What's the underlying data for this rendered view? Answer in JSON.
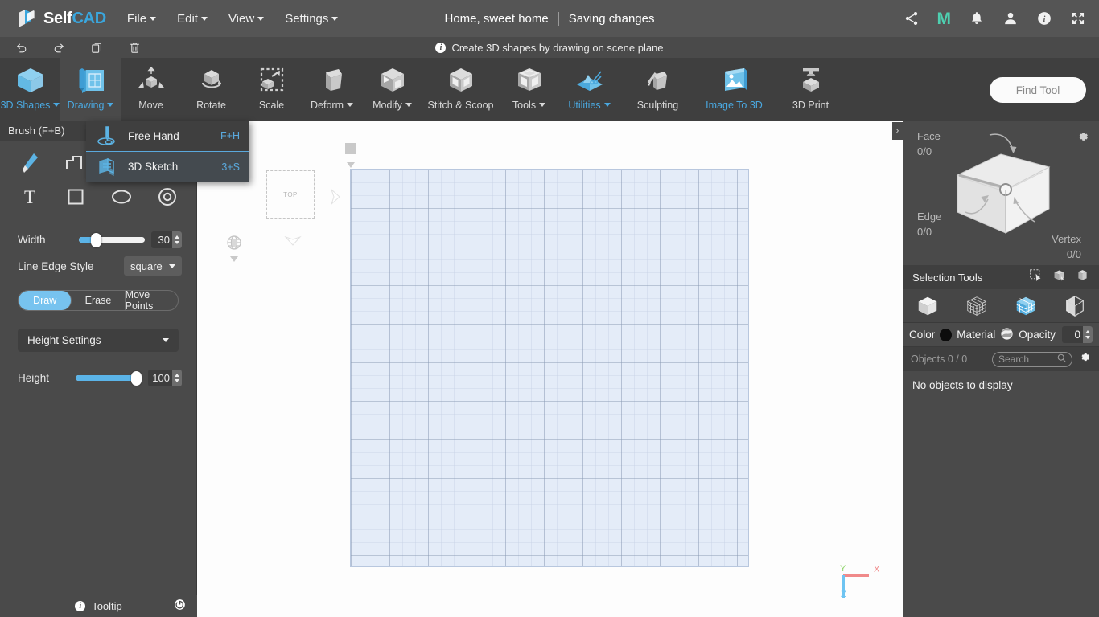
{
  "app": {
    "brand_self": "Self",
    "brand_cad": "CAD",
    "accent_blue": "#4aa8e0",
    "slider_blue": "#5bb4e8",
    "teal": "#4ecfb0"
  },
  "menubar": {
    "items": [
      {
        "label": "File",
        "has_caret": true
      },
      {
        "label": "Edit",
        "has_caret": true
      },
      {
        "label": "View",
        "has_caret": true
      },
      {
        "label": "Settings",
        "has_caret": true
      }
    ],
    "document_title": "Home, sweet home",
    "save_status": "Saving changes",
    "right_icons": [
      {
        "name": "share-icon"
      },
      {
        "name": "mythica-m-logo",
        "glyph": "M"
      },
      {
        "name": "notifications-bell-icon"
      },
      {
        "name": "user-account-icon"
      },
      {
        "name": "info-icon"
      },
      {
        "name": "fullscreen-icon"
      }
    ]
  },
  "quickbar": {
    "icons": [
      {
        "name": "undo-icon"
      },
      {
        "name": "redo-icon"
      },
      {
        "name": "copy-icon"
      },
      {
        "name": "delete-icon"
      }
    ],
    "hint": "Create 3D shapes by drawing on scene plane"
  },
  "ribbon": {
    "items": [
      {
        "label": "3D Shapes",
        "caret": true,
        "selected": true,
        "pane": false,
        "icon": "cube-icon"
      },
      {
        "label": "Drawing",
        "caret": true,
        "selected": true,
        "pane": true,
        "icon": "drawing-pencil-icon"
      },
      {
        "label": "Move",
        "caret": false,
        "selected": false,
        "pane": false,
        "icon": "move-arrows-icon"
      },
      {
        "label": "Rotate",
        "caret": false,
        "selected": false,
        "pane": false,
        "icon": "rotate-icon"
      },
      {
        "label": "Scale",
        "caret": false,
        "selected": false,
        "pane": false,
        "icon": "scale-icon"
      },
      {
        "label": "Deform",
        "caret": true,
        "selected": false,
        "pane": false,
        "icon": "deform-icon"
      },
      {
        "label": "Modify",
        "caret": true,
        "selected": false,
        "pane": false,
        "icon": "modify-icon"
      },
      {
        "label": "Stitch & Scoop",
        "caret": false,
        "selected": false,
        "pane": false,
        "icon": "stitch-scoop-icon"
      },
      {
        "label": "Tools",
        "caret": true,
        "selected": false,
        "pane": false,
        "icon": "tools-icon"
      },
      {
        "label": "Utilities",
        "caret": true,
        "selected": true,
        "pane": false,
        "icon": "utilities-scissors-icon"
      },
      {
        "label": "Sculpting",
        "caret": false,
        "selected": false,
        "pane": false,
        "icon": "sculpting-icon"
      },
      {
        "label": "Image To 3D",
        "caret": false,
        "selected": true,
        "pane": false,
        "icon": "image-to-3d-icon"
      },
      {
        "label": "3D Print",
        "caret": false,
        "selected": false,
        "pane": false,
        "icon": "3d-print-icon"
      }
    ],
    "find_tool_placeholder": "Find Tool"
  },
  "dropdown": {
    "open_for": "Drawing",
    "items": [
      {
        "label": "Free Hand",
        "shortcut": "F+H",
        "icon": "free-hand-icon",
        "highlighted": false
      },
      {
        "label": "3D Sketch",
        "shortcut": "3+S",
        "icon": "3d-sketch-icon",
        "highlighted": true
      }
    ]
  },
  "left_panel": {
    "header": "Brush (F+B)",
    "tools": [
      {
        "name": "brush-tool-icon"
      },
      {
        "name": "polyline-tool-icon"
      },
      {
        "name": "text-tool-icon"
      },
      {
        "name": "rectangle-tool-icon"
      },
      {
        "name": "ellipse-tool-icon"
      },
      {
        "name": "circle-tool-icon"
      }
    ],
    "width": {
      "label": "Width",
      "value": "30",
      "percent": 22
    },
    "line_edge_style": {
      "label": "Line Edge Style",
      "value": "square"
    },
    "modes": [
      {
        "label": "Draw",
        "active": true
      },
      {
        "label": "Erase",
        "active": false
      },
      {
        "label": "Move Points",
        "active": false
      }
    ],
    "height_settings": {
      "label": "Height Settings"
    },
    "height": {
      "label": "Height",
      "value": "100",
      "percent": 100
    },
    "tooltip": "Tooltip"
  },
  "viewport": {
    "view_cube_label": "TOP",
    "axis": {
      "x": "X",
      "y": "Y",
      "z": "Z"
    },
    "grid_color": "#e4ecf8"
  },
  "right_panel": {
    "counters": [
      {
        "label": "Face",
        "value": "0/0"
      },
      {
        "label": "Edge",
        "value": "0/0"
      },
      {
        "label": "Vertex",
        "value": "0/0"
      }
    ],
    "selection_tools_label": "Selection Tools",
    "selection_tool_icons": [
      {
        "name": "rectangle-select-icon"
      },
      {
        "name": "object-select-icon"
      },
      {
        "name": "box-select-icon"
      }
    ],
    "view_modes": [
      {
        "name": "solid-view-icon",
        "active": false
      },
      {
        "name": "wireframe-view-icon",
        "active": false
      },
      {
        "name": "shaded-grid-view-icon",
        "active": true
      },
      {
        "name": "transparent-view-icon",
        "active": false
      }
    ],
    "material_row": {
      "color_label": "Color",
      "color_value": "#0c0c0c",
      "material_label": "Material",
      "opacity_label": "Opacity",
      "opacity_value": "0"
    },
    "objects_label": "Objects 0 / 0",
    "search_placeholder": "Search",
    "empty_message": "No objects to display"
  }
}
